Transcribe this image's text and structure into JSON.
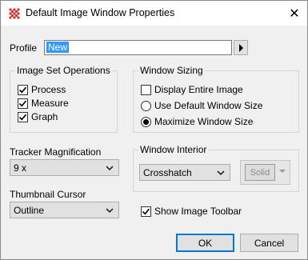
{
  "window": {
    "title": "Default Image Window Properties",
    "close_glyph": "✕"
  },
  "profile": {
    "label": "Profile",
    "value": "New",
    "arrow_icon": "triangle-right-icon"
  },
  "image_set_operations": {
    "title": "Image Set Operations",
    "items": [
      {
        "label": "Process",
        "checked": true
      },
      {
        "label": "Measure",
        "checked": true
      },
      {
        "label": "Graph",
        "checked": true
      }
    ]
  },
  "window_sizing": {
    "title": "Window Sizing",
    "display_entire": {
      "label": "Display Entire Image",
      "checked": false
    },
    "use_default": {
      "label": "Use Default Window Size",
      "selected": false
    },
    "maximize": {
      "label": "Maximize Window Size",
      "selected": true
    }
  },
  "tracker_magnification": {
    "label": "Tracker Magnification",
    "value": "9 x"
  },
  "thumbnail_cursor": {
    "label": "Thumbnail Cursor",
    "value": "Outline"
  },
  "window_interior": {
    "title": "Window Interior",
    "pattern_value": "Crosshatch",
    "color_button_label": "Solid"
  },
  "show_toolbar": {
    "label": "Show Image Toolbar",
    "checked": true
  },
  "buttons": {
    "ok": "OK",
    "cancel": "Cancel"
  },
  "colors": {
    "selection": "#3399ff",
    "dialog_bg": "#f0f0f0",
    "icon_red": "#d32f2f"
  }
}
